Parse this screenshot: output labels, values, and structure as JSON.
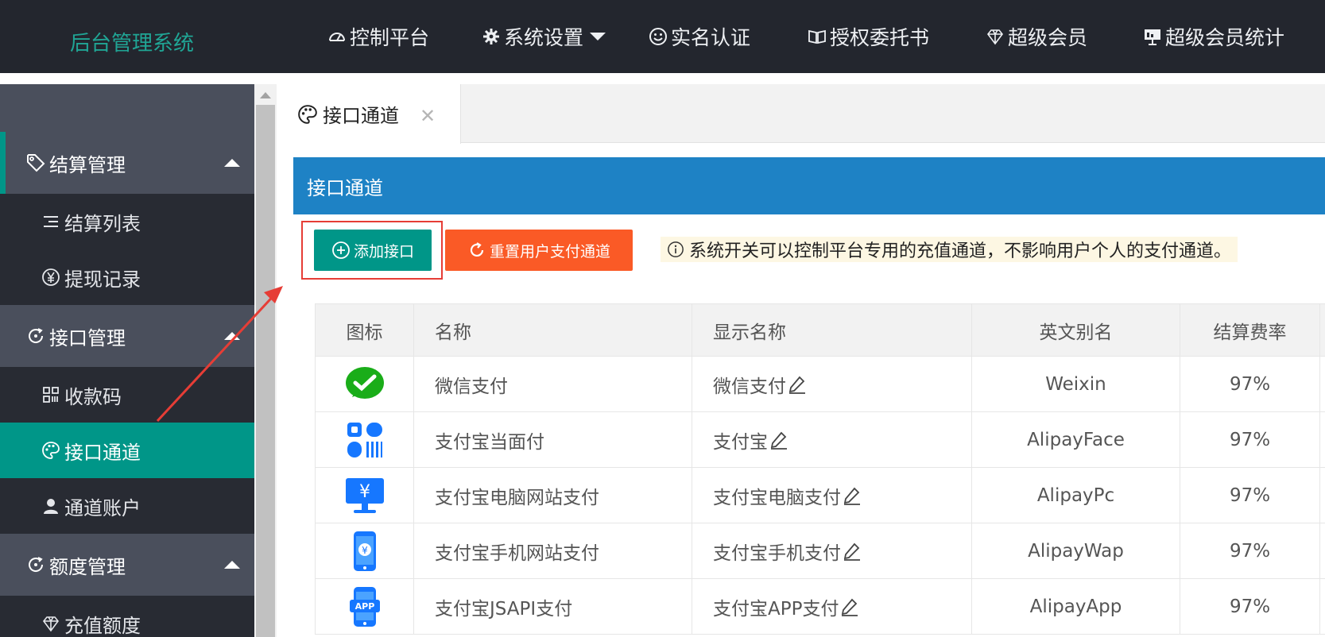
{
  "app": {
    "title": "后台管理系统"
  },
  "nav": [
    {
      "label": "控制平台",
      "icon": "dashboard-icon"
    },
    {
      "label": "系统设置",
      "icon": "gear-icon",
      "dropdown": true
    },
    {
      "label": "实名认证",
      "icon": "smile-icon"
    },
    {
      "label": "授权委托书",
      "icon": "book-icon"
    },
    {
      "label": "超级会员",
      "icon": "diamond-icon"
    },
    {
      "label": "超级会员统计",
      "icon": "presentation-icon"
    }
  ],
  "sidebar": {
    "groups": [
      {
        "label": "结算管理",
        "icon": "tag-icon",
        "expanded": true,
        "items": [
          {
            "label": "结算列表",
            "icon": "list-icon"
          },
          {
            "label": "提现记录",
            "icon": "yen-circle-icon"
          }
        ]
      },
      {
        "label": "接口管理",
        "icon": "refresh-circle-icon",
        "expanded": true,
        "items": [
          {
            "label": "收款码",
            "icon": "qrcode-icon"
          },
          {
            "label": "接口通道",
            "icon": "palette-icon",
            "active": true
          },
          {
            "label": "通道账户",
            "icon": "user-icon"
          }
        ]
      },
      {
        "label": "额度管理",
        "icon": "refresh-circle-icon",
        "expanded": true,
        "items": [
          {
            "label": "充值额度",
            "icon": "diamond-icon"
          }
        ]
      }
    ]
  },
  "tabs": [
    {
      "label": "接口通道",
      "icon": "palette-icon",
      "closable": true
    }
  ],
  "panel": {
    "title": "接口通道",
    "add_button": "添加接口",
    "reset_button": "重置用户支付通道",
    "notice": "系统开关可以控制平台专用的充值通道，不影响用户个人的支付通道。"
  },
  "table": {
    "headers": [
      "图标",
      "名称",
      "显示名称",
      "英文别名",
      "结算费率"
    ],
    "rows": [
      {
        "icon": "wechat-pay-icon",
        "name": "微信支付",
        "display": "微信支付",
        "alias": "Weixin",
        "rate": "97%"
      },
      {
        "icon": "alipay-face-icon",
        "name": "支付宝当面付",
        "display": "支付宝",
        "alias": "AlipayFace",
        "rate": "97%"
      },
      {
        "icon": "alipay-pc-icon",
        "name": "支付宝电脑网站支付",
        "display": "支付宝电脑支付",
        "alias": "AlipayPc",
        "rate": "97%"
      },
      {
        "icon": "alipay-wap-icon",
        "name": "支付宝手机网站支付",
        "display": "支付宝手机支付",
        "alias": "AlipayWap",
        "rate": "97%"
      },
      {
        "icon": "alipay-app-icon",
        "name": "支付宝JSAPI支付",
        "display": "支付宝APP支付",
        "alias": "AlipayApp",
        "rate": "97%"
      }
    ]
  },
  "app_badge_text": "APP",
  "colors": {
    "header": "#23262e",
    "brand": "#20a595",
    "sidebar": "#393d49",
    "active": "#009688",
    "panel_head": "#1e82c5",
    "reset": "#fa5a26",
    "highlight": "#e63d36"
  }
}
